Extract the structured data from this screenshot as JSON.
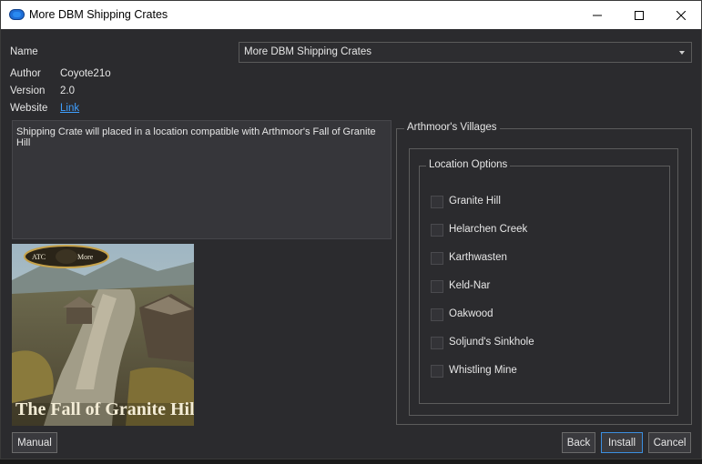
{
  "window": {
    "title": "More DBM Shipping Crates",
    "icon": "app-cloud-icon"
  },
  "info": {
    "name_label": "Name",
    "name_value": "More DBM Shipping Crates",
    "author_label": "Author",
    "author_value": "Coyote21o",
    "version_label": "Version",
    "version_value": "2.0",
    "website_label": "Website",
    "website_link": "Link"
  },
  "description": "Shipping Crate will placed in a location compatible with Arthmoor's Fall of Granite Hill",
  "preview": {
    "caption": "The Fall of Granite Hill",
    "badge_left": "ATC",
    "badge_right": "More"
  },
  "group": {
    "title": "Arthmoor's Villages",
    "inner_title": "Location Options",
    "options": [
      {
        "label": "Granite Hill",
        "checked": false
      },
      {
        "label": "Helarchen Creek",
        "checked": false
      },
      {
        "label": "Karthwasten",
        "checked": false
      },
      {
        "label": "Keld-Nar",
        "checked": false
      },
      {
        "label": "Oakwood",
        "checked": false
      },
      {
        "label": "Soljund's Sinkhole",
        "checked": false
      },
      {
        "label": "Whistling Mine",
        "checked": false
      }
    ]
  },
  "buttons": {
    "manual": "Manual",
    "back": "Back",
    "install": "Install",
    "cancel": "Cancel"
  },
  "colors": {
    "background": "#2b2b2e",
    "link": "#3f9fff",
    "primary_border": "#3c8fe0"
  }
}
